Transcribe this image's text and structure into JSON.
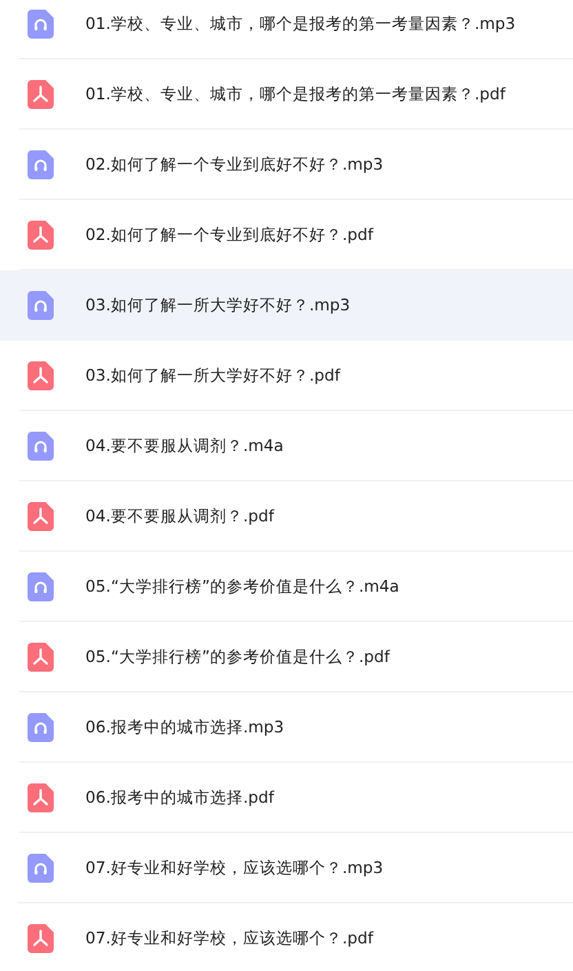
{
  "files": [
    {
      "kind": "audio",
      "name": "01.学校、专业、城市，哪个是报考的第一考量因素？.mp3",
      "selected": false
    },
    {
      "kind": "pdf",
      "name": "01.学校、专业、城市，哪个是报考的第一考量因素？.pdf",
      "selected": false
    },
    {
      "kind": "audio",
      "name": "02.如何了解一个专业到底好不好？.mp3",
      "selected": false
    },
    {
      "kind": "pdf",
      "name": "02.如何了解一个专业到底好不好？.pdf",
      "selected": false
    },
    {
      "kind": "audio",
      "name": "03.如何了解一所大学好不好？.mp3",
      "selected": true
    },
    {
      "kind": "pdf",
      "name": "03.如何了解一所大学好不好？.pdf",
      "selected": false
    },
    {
      "kind": "audio",
      "name": "04.要不要服从调剂？.m4a",
      "selected": false
    },
    {
      "kind": "pdf",
      "name": "04.要不要服从调剂？.pdf",
      "selected": false
    },
    {
      "kind": "audio",
      "name": "05.“大学排行榜”的参考价值是什么？.m4a",
      "selected": false
    },
    {
      "kind": "pdf",
      "name": "05.“大学排行榜”的参考价值是什么？.pdf",
      "selected": false
    },
    {
      "kind": "audio",
      "name": "06.报考中的城市选择.mp3",
      "selected": false
    },
    {
      "kind": "pdf",
      "name": "06.报考中的城市选择.pdf",
      "selected": false
    },
    {
      "kind": "audio",
      "name": "07.好专业和好学校，应该选哪个？.mp3",
      "selected": false
    },
    {
      "kind": "pdf",
      "name": "07.好专业和好学校，应该选哪个？.pdf",
      "selected": false
    }
  ]
}
